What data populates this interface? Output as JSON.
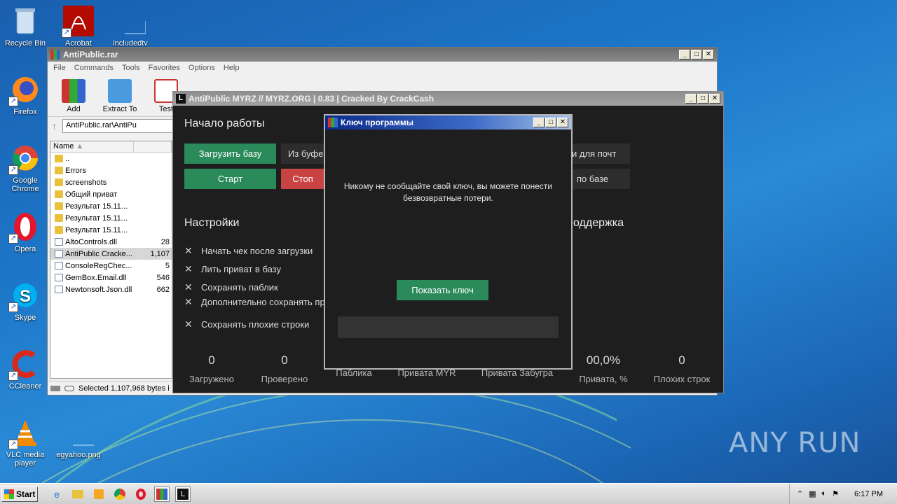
{
  "desktop": {
    "icons": [
      {
        "label": "Recycle Bin",
        "icon": "recycle-bin-icon"
      },
      {
        "label": "Acrobat",
        "icon": "acrobat-icon"
      },
      {
        "label": "includedtv",
        "icon": "blank-file-icon"
      },
      {
        "label": "Firefox",
        "icon": "firefox-icon"
      },
      {
        "label": "Google Chrome",
        "icon": "chrome-icon"
      },
      {
        "label": "Opera",
        "icon": "opera-icon"
      },
      {
        "label": "Skype",
        "icon": "skype-icon"
      },
      {
        "label": "CCleaner",
        "icon": "ccleaner-icon"
      },
      {
        "label": "VLC media player",
        "icon": "vlc-icon"
      },
      {
        "label": "egyahoo.png",
        "icon": "blank-file-icon"
      }
    ],
    "watermark": "ANY RUN"
  },
  "winrar": {
    "title": "AntiPublic.rar",
    "menu": [
      "File",
      "Commands",
      "Tools",
      "Favorites",
      "Options",
      "Help"
    ],
    "tools": [
      {
        "label": "Add",
        "icon": "winrar-add-icon"
      },
      {
        "label": "Extract To",
        "icon": "folder-extract-icon"
      },
      {
        "label": "Test",
        "icon": "test-clipboard-icon"
      }
    ],
    "address": "AntiPublic.rar\\AntiPu",
    "column_name": "Name",
    "files": [
      {
        "name": "..",
        "size": "",
        "type": "folder"
      },
      {
        "name": "Errors",
        "size": "",
        "type": "folder"
      },
      {
        "name": "screenshots",
        "size": "",
        "type": "folder"
      },
      {
        "name": "Общий приват",
        "size": "",
        "type": "folder"
      },
      {
        "name": "Результат 15.11...",
        "size": "",
        "type": "folder"
      },
      {
        "name": "Результат 15.11...",
        "size": "",
        "type": "folder"
      },
      {
        "name": "Результат 15.11...",
        "size": "",
        "type": "folder"
      },
      {
        "name": "AltoControls.dll",
        "size": "28",
        "type": "file"
      },
      {
        "name": "AntiPublic Cracke...",
        "size": "1,107",
        "type": "file",
        "selected": true
      },
      {
        "name": "ConsoleRegChec...",
        "size": "5",
        "type": "file"
      },
      {
        "name": "GemBox.Email.dll",
        "size": "546",
        "type": "file"
      },
      {
        "name": "Newtonsoft.Json.dll",
        "size": "662",
        "type": "file"
      }
    ],
    "status": "Selected 1,107,968 bytes i"
  },
  "antipublic": {
    "title": "AntiPublic MYRZ // MYRZ.ORG | 0.83 | Cracked By CrackCash",
    "logo": "L",
    "section_start": "Начало работы",
    "btn_load": "Загрузить базу",
    "btn_from_buffer": "Из буфе",
    "btn_start": "Старт",
    "btn_stop": "Стоп",
    "btn_for_mail": "и для почт",
    "btn_by_base": "по базе",
    "section_settings": "Настройки",
    "section_support": "оддержка",
    "options": [
      "Начать чек после загрузки",
      "Лить приват в базу",
      "Сохранять паблик",
      "Дополнительно сохранять пр",
      "Сохранять плохие строки"
    ],
    "stats": [
      {
        "value": "0",
        "label": "Загружено"
      },
      {
        "value": "0",
        "label": "Проверено"
      },
      {
        "value": "",
        "label": "Паблика"
      },
      {
        "value": "",
        "label": "Привата MYR"
      },
      {
        "value": "",
        "label": "Привата Забугра"
      },
      {
        "value": "00,0%",
        "label": "Привата, %"
      },
      {
        "value": "0",
        "label": "Плохих строк"
      }
    ]
  },
  "keydialog": {
    "title": "Ключ программы",
    "message": "Никому не сообщайте свой ключ, вы можете понести безвозвратные потери.",
    "show_key": "Показать ключ",
    "key_value": ""
  },
  "taskbar": {
    "start": "Start",
    "clock": "6:17 PM"
  }
}
